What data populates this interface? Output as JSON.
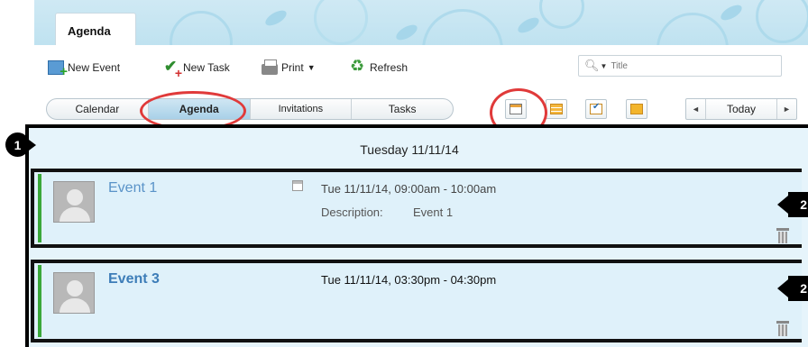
{
  "header": {
    "tab_label": "Agenda"
  },
  "toolbar": {
    "new_event": "New Event",
    "new_task": "New Task",
    "print": "Print",
    "refresh": "Refresh",
    "search_placeholder": "Title"
  },
  "views": {
    "tabs": [
      {
        "label": "Calendar",
        "active": false
      },
      {
        "label": "Agenda",
        "active": true
      },
      {
        "label": "Invitations",
        "active": false
      },
      {
        "label": "Tasks",
        "active": false
      }
    ],
    "icons": [
      "day-view-icon",
      "week-view-icon",
      "work-week-view-icon",
      "month-view-icon"
    ],
    "nav": {
      "today": "Today",
      "prev": "◄",
      "next": "►"
    }
  },
  "agenda": {
    "date": "Tuesday 11/11/14",
    "events": [
      {
        "title": "Event 1",
        "time": "Tue 11/11/14, 09:00am - 10:00am",
        "description_label": "Description:",
        "description": "Event 1"
      },
      {
        "title": "Event 3",
        "time": "Tue 11/11/14, 03:30pm - 04:30pm"
      }
    ]
  },
  "annotations": {
    "marker1": "1",
    "marker2": "2"
  },
  "colors": {
    "accent": "#3d7db8",
    "event_bar": "#3aa83a",
    "highlight": "#e03a3a",
    "agenda_bg": "#e6f4fb"
  }
}
